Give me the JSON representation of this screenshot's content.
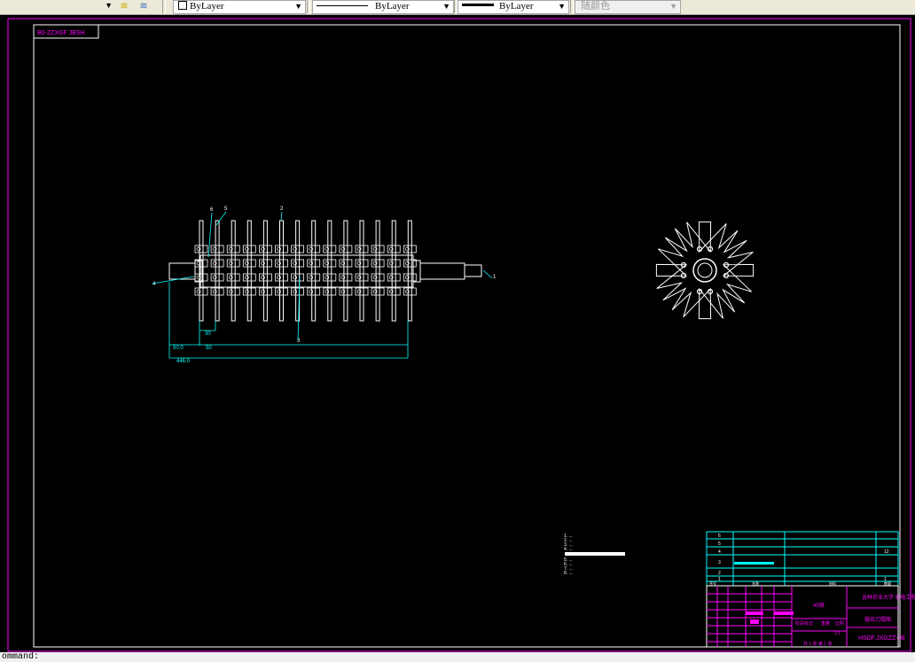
{
  "toolbar": {
    "color_control": "ByLayer",
    "linetype_control": "ByLayer",
    "lineweight_control": "ByLayer",
    "plotstyle_control": "随颜色",
    "layer_icons": [
      "layer-previous-icon",
      "layer-states-icon"
    ]
  },
  "drawing": {
    "frame_label": "B0-ZZXGF JBSH",
    "balloons": [
      "6",
      "5",
      "2",
      "4",
      "3",
      "1"
    ],
    "dimensions": {
      "pitch": "30",
      "offset": "50.0",
      "small": "50",
      "overall": "446.0"
    },
    "notes": [
      "1. ...",
      "2. ...",
      "3. ...",
      "4. ...",
      "5. ...",
      "6. ...",
      "7. ...",
      "8. ..."
    ],
    "parts_list": {
      "rows": [
        {
          "no": "6",
          "name": "",
          "qty": ""
        },
        {
          "no": "5",
          "name": "",
          "qty": ""
        },
        {
          "no": "4",
          "name": "",
          "qty": "12"
        },
        {
          "no": "3",
          "name": "",
          "qty": ""
        },
        {
          "no": "2",
          "name": "",
          "qty": ""
        },
        {
          "no": "1",
          "name": "",
          "qty": "1"
        }
      ],
      "header": [
        "序号",
        "名称",
        "材料",
        "数量"
      ]
    },
    "title_block": {
      "material": "45钢",
      "school": "吉林农业大学 机电工程学院",
      "drawing_name": "锯齿刀辊图",
      "drawing_number": "HSDF.JXGZZ-08",
      "scale": "1:1",
      "stage_label": "阶段标记",
      "weight_label": "重量",
      "scale_label": "比例",
      "sheet": "共 1 张 第 1 张"
    },
    "colors": {
      "frame": "#ff00ff",
      "border": "#ffffff",
      "annotation": "#00ffff",
      "geometry": "#ffffff"
    }
  },
  "command_line": {
    "text": "ommand: "
  }
}
